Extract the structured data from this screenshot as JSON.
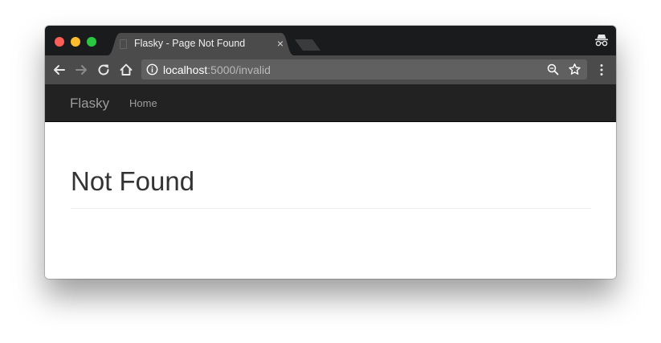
{
  "tab": {
    "title": "Flasky - Page Not Found"
  },
  "address_bar": {
    "host": "localhost",
    "rest": ":5000/invalid"
  },
  "navbar": {
    "brand": "Flasky",
    "links": [
      {
        "label": "Home"
      }
    ]
  },
  "page": {
    "heading": "Not Found"
  },
  "colors": {
    "titlebar": "#1a1b1d",
    "toolbar": "#4b4b4c",
    "omnibox": "#606061",
    "navbar": "#222222",
    "nav_text": "#9d9d9d",
    "heading": "#333333",
    "close_red": "#fc5f57",
    "minimize_yellow": "#fdbc2e",
    "zoom_green": "#28c840"
  },
  "icons": {
    "tab_close": "×"
  }
}
